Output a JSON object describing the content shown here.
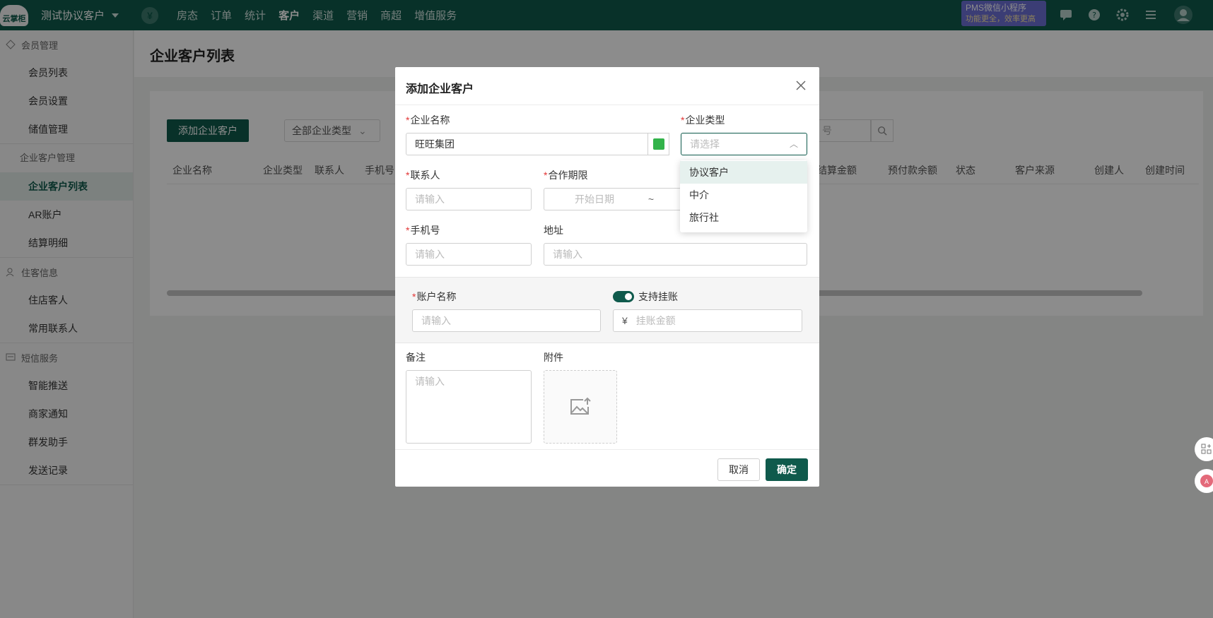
{
  "topbar": {
    "logo_text": "云掌柜",
    "hotel_name": "测试协议客户",
    "nav": [
      "房态",
      "订单",
      "统计",
      "客户",
      "渠道",
      "营销",
      "商超",
      "增值服务"
    ],
    "active_nav": "客户",
    "promo_line1": "PMS微信小程序",
    "promo_line2": "功能更全，效率更高"
  },
  "sidebar": {
    "group_member": "会员管理",
    "member_items": [
      "会员列表",
      "会员设置",
      "储值管理"
    ],
    "group_enterprise": "企业客户管理",
    "enterprise_items": [
      "企业客户列表",
      "AR账户",
      "结算明细"
    ],
    "group_guest": "住客信息",
    "guest_items": [
      "住店客人",
      "常用联系人"
    ],
    "group_sms": "短信服务",
    "sms_items": [
      "智能推送",
      "商家通知",
      "群发助手",
      "发送记录"
    ]
  },
  "page": {
    "title": "企业客户列表",
    "add_button": "添加企业客户",
    "type_filter": "全部企业类型",
    "search_placeholder": "号",
    "columns": [
      "企业名称",
      "企业类型",
      "联系人",
      "手机号",
      "结算金额",
      "预付款余额",
      "状态",
      "客户来源",
      "创建人",
      "创建时间"
    ]
  },
  "modal": {
    "title": "添加企业客户",
    "company_name_label": "企业名称",
    "company_name_value": "旺旺集团",
    "company_type_label": "企业类型",
    "company_type_placeholder": "请选择",
    "contact_label": "联系人",
    "contact_placeholder": "请输入",
    "period_label": "合作期限",
    "start_date_placeholder": "开始日期",
    "date_separator": "~",
    "phone_label": "手机号",
    "phone_placeholder": "请输入",
    "address_label": "地址",
    "address_placeholder": "请输入",
    "account_name_label": "账户名称",
    "account_name_placeholder": "请输入",
    "credit_toggle_label": "支持挂账",
    "credit_toggle_on": true,
    "credit_currency": "¥",
    "credit_amount_placeholder": "挂账金额",
    "remark_label": "备注",
    "remark_placeholder": "请输入",
    "attachment_label": "附件",
    "cancel_button": "取消",
    "confirm_button": "确定",
    "type_options": [
      "协议客户",
      "中介",
      "旅行社"
    ],
    "highlighted_option": "协议客户"
  },
  "colors": {
    "brand": "#0f5a4c",
    "company_color_swatch": "#32b34a",
    "required_marker": "#e23636"
  },
  "icons": [
    "yen-icon",
    "chat-icon",
    "help-icon",
    "settings-icon",
    "menu-icon",
    "user-avatar-icon",
    "close-icon",
    "search-icon",
    "upload-image-icon",
    "chevron-up-icon"
  ]
}
